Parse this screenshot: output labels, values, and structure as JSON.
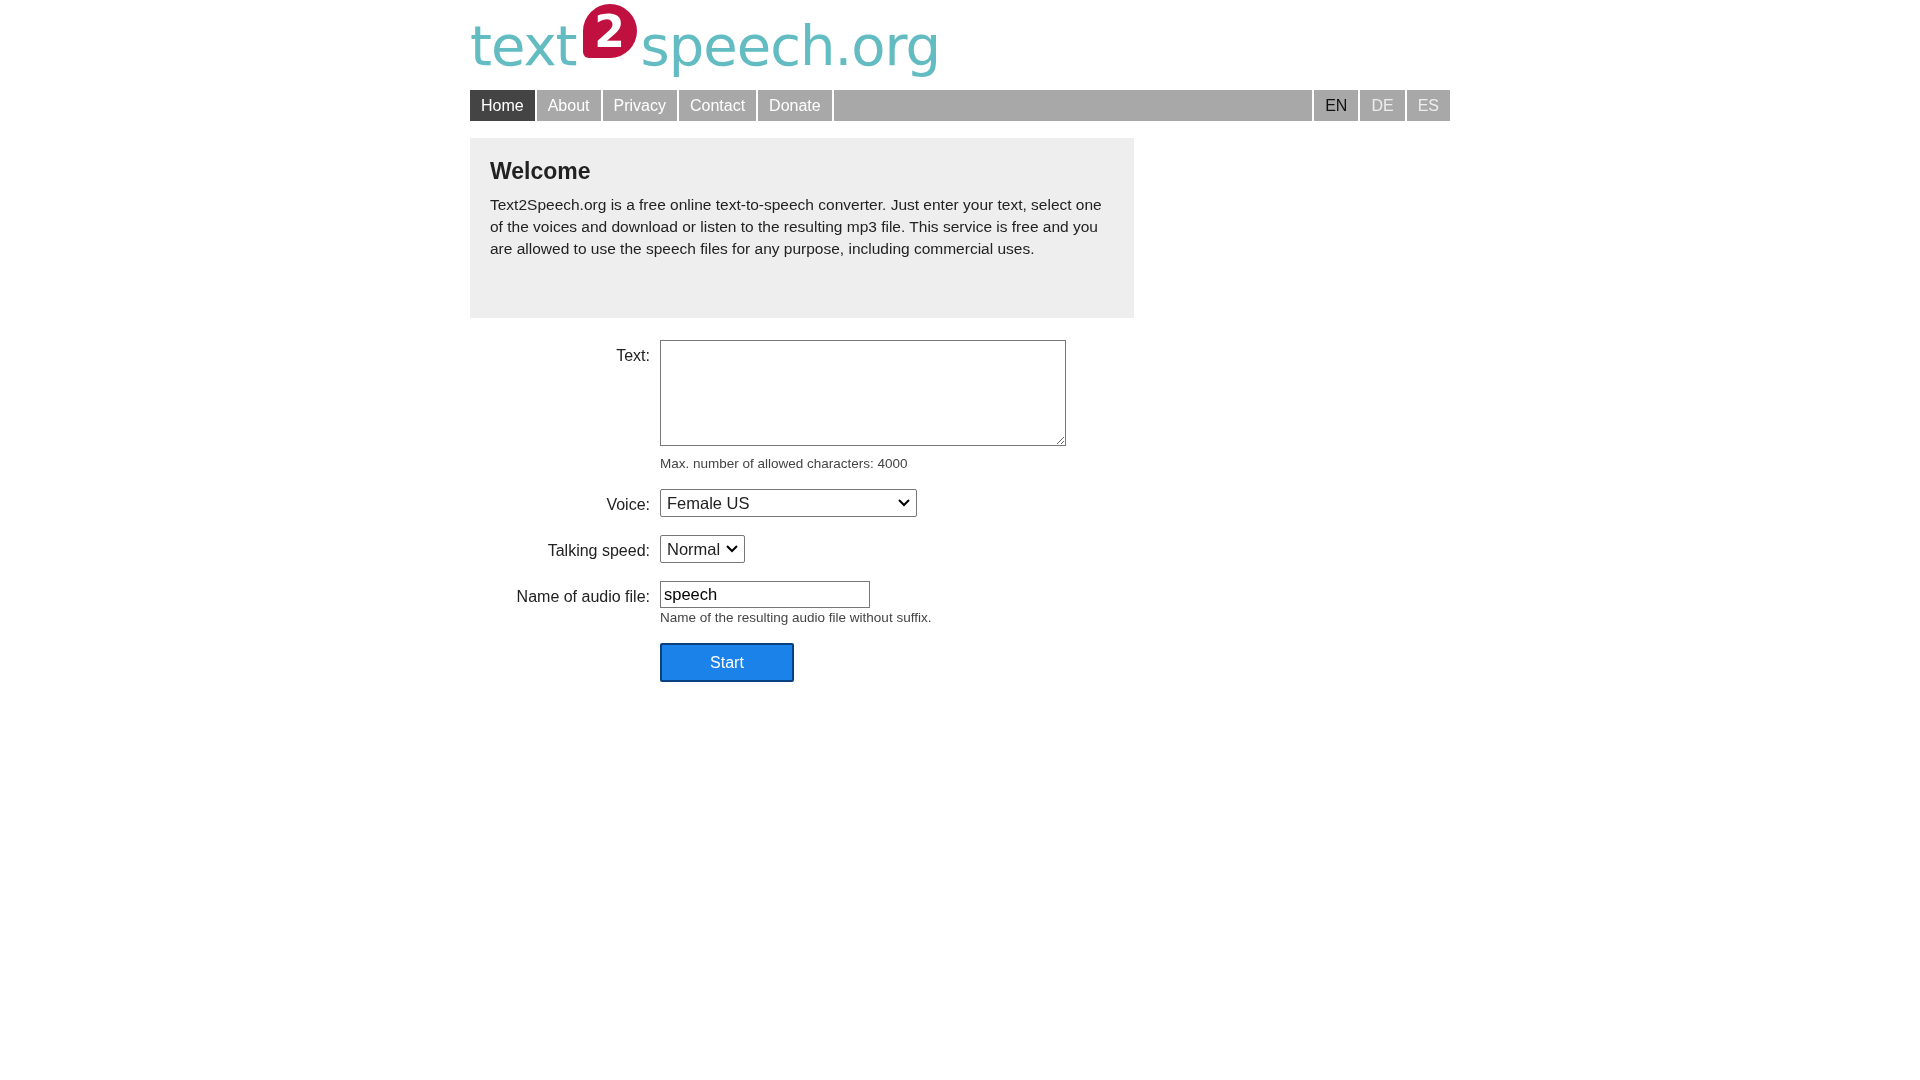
{
  "logo": {
    "left": "text",
    "badge": "2",
    "right": "speech.org"
  },
  "nav": [
    {
      "label": "Home",
      "selected": true
    },
    {
      "label": "About",
      "selected": false
    },
    {
      "label": "Privacy",
      "selected": false
    },
    {
      "label": "Contact",
      "selected": false
    },
    {
      "label": "Donate",
      "selected": false
    }
  ],
  "languages": [
    {
      "label": "EN",
      "selected": true
    },
    {
      "label": "DE",
      "selected": false
    },
    {
      "label": "ES",
      "selected": false
    }
  ],
  "welcome": {
    "title": "Welcome",
    "text": "Text2Speech.org is a free online text-to-speech converter. Just enter your text, select one of the voices and download or listen to the resulting mp3 file. This service is free and you are allowed to use the speech files for any purpose, including commercial uses."
  },
  "form": {
    "text_label": "Text:",
    "text_hint": "Max. number of allowed characters: 4000",
    "voice_label": "Voice:",
    "voice_value": "Female US",
    "speed_label": "Talking speed:",
    "speed_value": "Normal",
    "file_label": "Name of audio file:",
    "file_value": "speech",
    "file_hint": "Name of the resulting audio file without suffix.",
    "start": "Start"
  }
}
